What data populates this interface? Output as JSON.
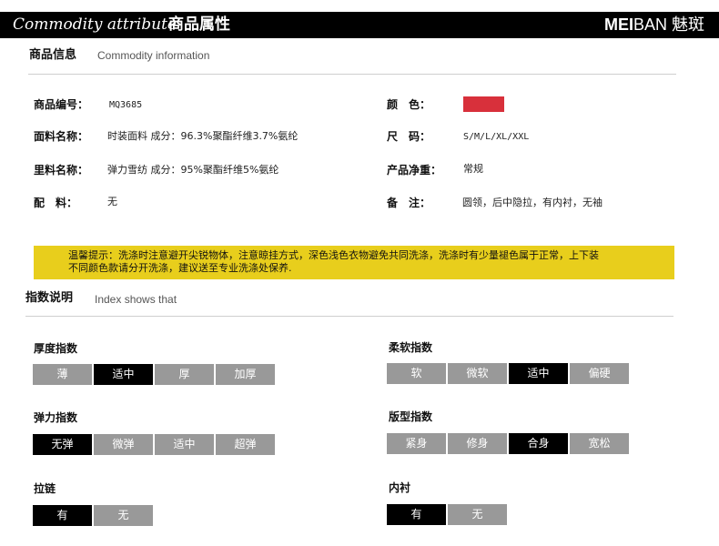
{
  "header": {
    "title_en": "Commodity attribute",
    "title_cn": "商品属性",
    "logo_bold": "MEI",
    "logo_thin": "BAN",
    "logo_cn": "魅斑"
  },
  "info_section": {
    "title": "商品信息",
    "subtitle": "Commodity information"
  },
  "attributes": [
    {
      "label": "商品编号：",
      "value": "MQ3685"
    },
    {
      "label": "面料名称：",
      "value": "时装面料 成分：96.3%聚酯纤维3.7%氨纶"
    },
    {
      "label": "里料名称：",
      "value": "弹力雪纺 成分：95%聚酯纤维5%氨纶"
    },
    {
      "label": "配　料：",
      "value": "无"
    },
    {
      "label": "颜　色：",
      "value": "",
      "color": "#d8303b"
    },
    {
      "label": "尺　码：",
      "value": "S/M/L/XL/XXL"
    },
    {
      "label": "产品净重：",
      "value": "常规"
    },
    {
      "label": "备　注：",
      "value": "圆领，后中隐拉，有内衬，无袖"
    }
  ],
  "notice": {
    "line1": "温馨提示：洗涤时注意避开尖锐物体，注意晾挂方式，深色浅色衣物避免共同洗涤，洗涤时有少量褪色属于正常，上下装",
    "line2": "不同颜色款请分开洗涤，建议送至专业洗涤处保养."
  },
  "index_section": {
    "title": "指数说明",
    "subtitle": "Index shows that"
  },
  "indices": [
    {
      "title": "厚度指数",
      "options": [
        "薄",
        "适中",
        "厚",
        "加厚"
      ],
      "selected": 1
    },
    {
      "title": "柔软指数",
      "options": [
        "软",
        "微软",
        "适中",
        "偏硬"
      ],
      "selected": 2
    },
    {
      "title": "弹力指数",
      "options": [
        "无弹",
        "微弹",
        "适中",
        "超弹"
      ],
      "selected": 0
    },
    {
      "title": "版型指数",
      "options": [
        "紧身",
        "修身",
        "合身",
        "宽松"
      ],
      "selected": 2
    },
    {
      "title": "拉链",
      "options": [
        "有",
        "无"
      ],
      "selected": 0
    },
    {
      "title": "内衬",
      "options": [
        "有",
        "无"
      ],
      "selected": 0
    }
  ],
  "colors": {
    "header_bg": "#000000",
    "notice_bg": "#e8ce1c",
    "cell_off": "#999999",
    "cell_on": "#000000"
  }
}
